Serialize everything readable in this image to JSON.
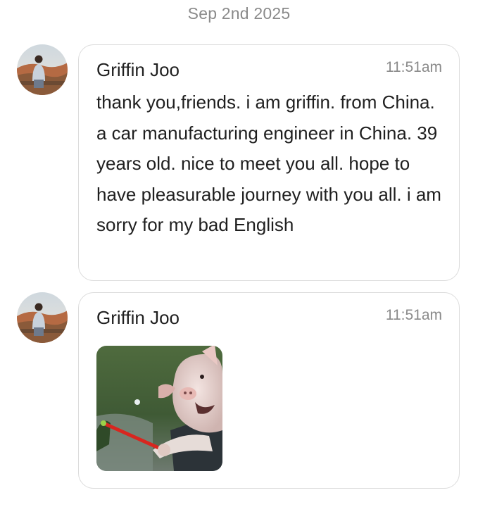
{
  "date_separator": "Sep 2nd 2025",
  "messages": [
    {
      "sender": "Griffin Joo",
      "time": "11:51am",
      "text": "thank you,friends. i am griffin. from China. a car manufacturing engineer in China. 39 years old. nice to meet you all. hope to have pleasurable journey with you all. i am sorry for my bad English"
    },
    {
      "sender": "Griffin Joo",
      "time": "11:51am",
      "attachment": "gif"
    }
  ],
  "colors": {
    "bubble_border": "#dcdcdc",
    "secondary_text": "#8a8a8a",
    "primary_text": "#1f1f1f"
  }
}
